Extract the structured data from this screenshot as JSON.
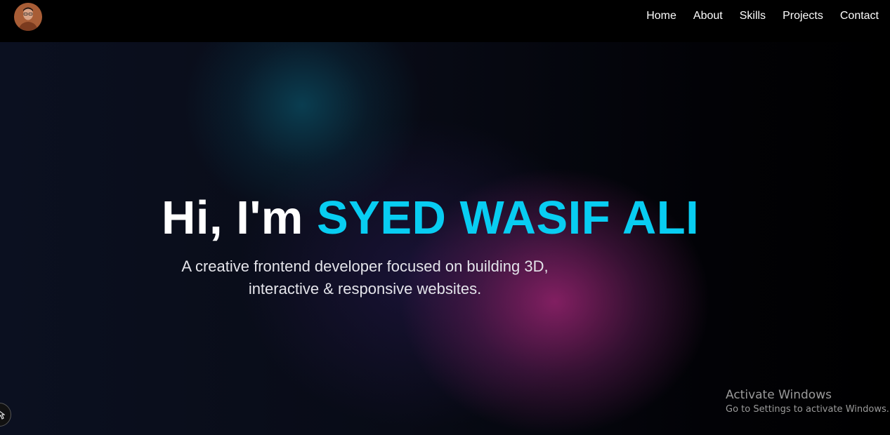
{
  "navbar": {
    "avatar_icon": "profile-photo-icon",
    "links": [
      {
        "label": "Home"
      },
      {
        "label": "About"
      },
      {
        "label": "Skills"
      },
      {
        "label": "Projects"
      },
      {
        "label": "Contact"
      }
    ]
  },
  "hero": {
    "greeting": "Hi, I'm ",
    "name": "SYED WASIF ALI",
    "subtitle_line1": "A creative frontend developer focused on building 3D,",
    "subtitle_line2": "interactive & responsive websites."
  },
  "watermark": {
    "title": "Activate Windows",
    "subtitle": "Go to Settings to activate Windows."
  },
  "colors": {
    "accent": "#08cdf2",
    "background": "#000000",
    "text": "#ffffff"
  }
}
